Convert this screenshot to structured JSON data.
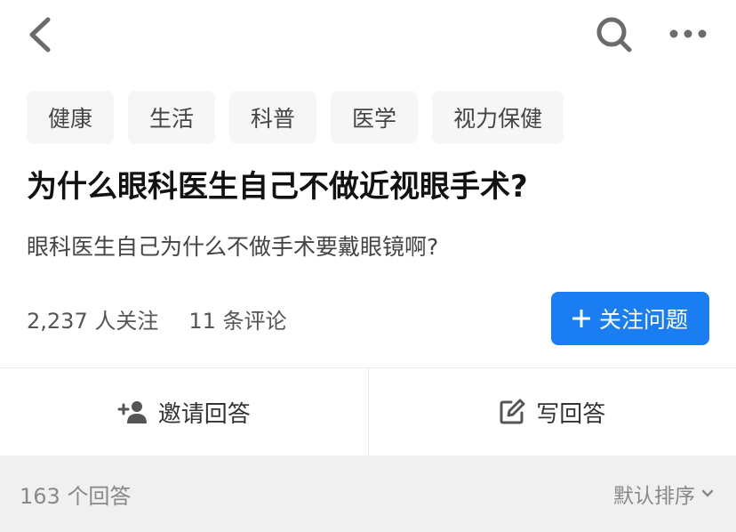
{
  "toolbar": {
    "back_icon": "chevron-left-icon",
    "search_icon": "search-icon",
    "more_icon": "more-horizontal-icon"
  },
  "tags": [
    "健康",
    "生活",
    "科普",
    "医学",
    "视力保健"
  ],
  "question": {
    "title": "为什么眼科医生自己不做近视眼手术?",
    "detail": "眼科医生自己为什么不做手术要戴眼镜啊?",
    "followers": "2,237 人关注",
    "comments": "11 条评论",
    "follow_button": "关注问题"
  },
  "actions": {
    "invite": "邀请回答",
    "write": "写回答"
  },
  "answers": {
    "count": "163 个回答",
    "sort": "默认排序"
  },
  "colors": {
    "accent": "#1a7ef2",
    "tag_bg": "#f6f6f6",
    "answers_bar_bg": "#f0f0f0"
  }
}
